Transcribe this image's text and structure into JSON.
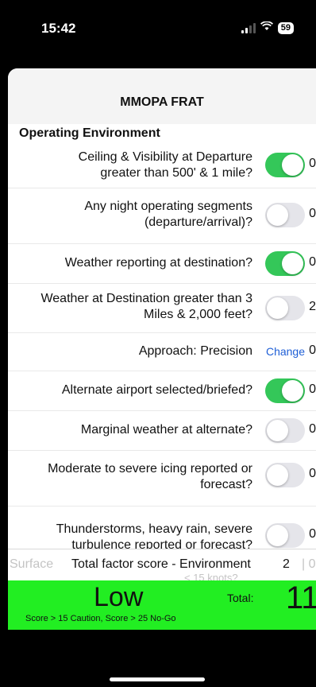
{
  "status": {
    "time": "15:42",
    "battery": "59"
  },
  "nav": {
    "title": "MMOPA FRAT"
  },
  "section": {
    "title": "Operating Environment"
  },
  "rows": [
    {
      "label": "Ceiling & Visibility at Departure greater than 500' & 1 mile?",
      "toggle": "on",
      "score": "0"
    },
    {
      "label": "Any night operating segments (departure/arrival)?",
      "toggle": "off",
      "score": "0"
    },
    {
      "label": "Weather reporting at destination?",
      "toggle": "on",
      "score": "0"
    },
    {
      "label": "Weather at Destination greater than 3 Miles & 2,000 feet?",
      "toggle": "off",
      "score": "2"
    },
    {
      "label": "Approach: Precision",
      "action": "Change",
      "score": "0"
    },
    {
      "label": "Alternate airport selected/briefed?",
      "toggle": "on",
      "score": "0"
    },
    {
      "label": "Marginal weather at alternate?",
      "toggle": "off",
      "score": "0"
    },
    {
      "label": "Moderate to severe icing reported or forecast?",
      "toggle": "off",
      "score": "0"
    },
    {
      "label": "Thunderstorms, heavy rain, severe turbulence reported or forecast?",
      "toggle": "off",
      "score": "0"
    }
  ],
  "summary": {
    "ghost_label": "Surface",
    "ghost_under": "< 15 knots?",
    "ghost_divider": "| 0",
    "env_total_label": "Total factor score - Environment",
    "env_total_score": "2"
  },
  "risk": {
    "level": "Low",
    "note": "Score > 15 Caution, Score > 25 No-Go",
    "total_label": "Total:",
    "total_value": "11",
    "color": "#22ee22"
  },
  "colors": {
    "toggle_on": "#34c759",
    "toggle_off": "#e5e5ea",
    "link": "#1f5fd6"
  },
  "icons": [
    "signal-icon",
    "wifi-icon",
    "battery-icon"
  ]
}
